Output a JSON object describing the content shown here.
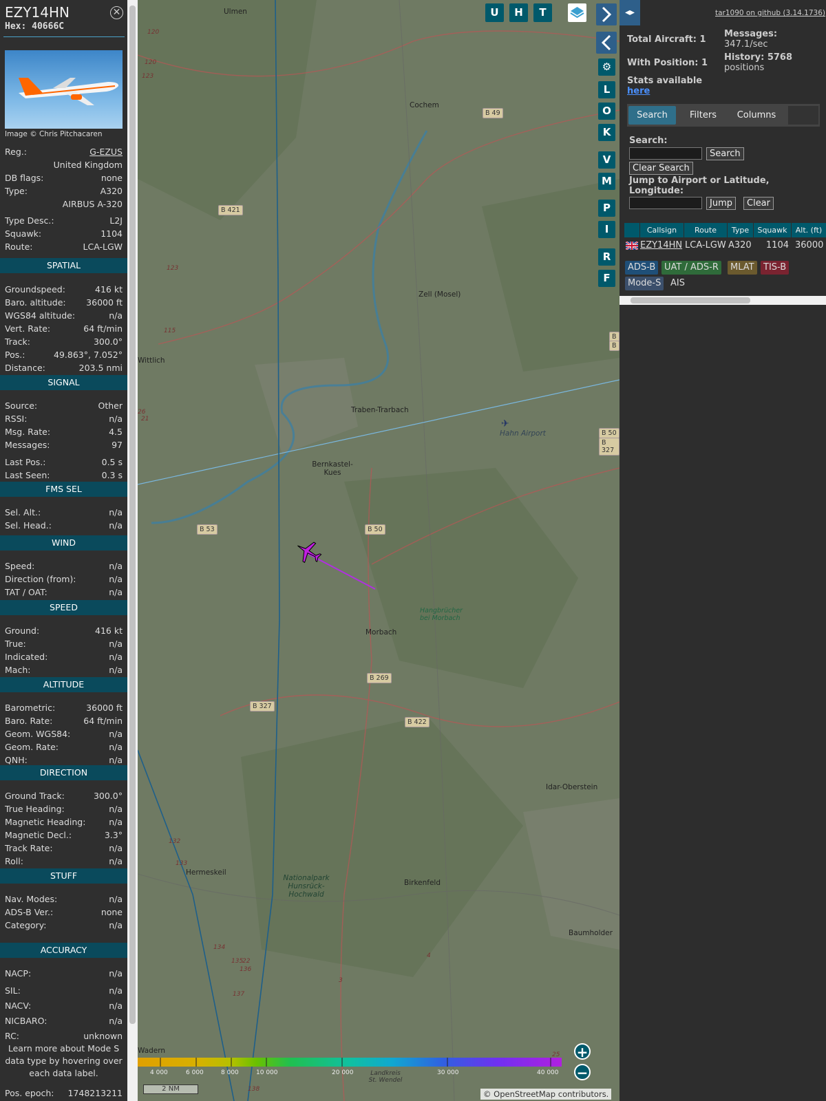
{
  "infoblock": {
    "callsign": "EZY14HN",
    "hex": "Hex: 40666C",
    "photo_caption": "Image © Chris Pitchacaren",
    "general": [
      {
        "k": "Reg.:",
        "v": "G-EZUS",
        "link": true
      },
      {
        "k": "",
        "v": "United Kingdom"
      },
      {
        "k": "DB flags:",
        "v": "none"
      },
      {
        "k": "Type:",
        "v": "A320"
      },
      {
        "k": "",
        "v": "AIRBUS A-320"
      },
      {
        "k": "Type Desc.:",
        "v": "L2J"
      },
      {
        "k": "Squawk:",
        "v": "1104"
      },
      {
        "k": "Route:",
        "v": "LCA-LGW"
      }
    ],
    "sections": [
      {
        "title": "SPATIAL",
        "rows": [
          {
            "k": "Groundspeed:",
            "v": "416 kt"
          },
          {
            "k": "Baro. altitude:",
            "v": "36000 ft"
          },
          {
            "k": "WGS84 altitude:",
            "v": "n/a"
          },
          {
            "k": "Vert. Rate:",
            "v": "64 ft/min"
          },
          {
            "k": "Track:",
            "v": "300.0°"
          },
          {
            "k": "Pos.:",
            "v": "49.863°, 7.052°"
          },
          {
            "k": "Distance:",
            "v": "203.5 nmi"
          }
        ]
      },
      {
        "title": "SIGNAL",
        "rows": [
          {
            "k": "Source:",
            "v": "Other"
          },
          {
            "k": "RSSI:",
            "v": "n/a"
          },
          {
            "k": "Msg. Rate:",
            "v": "4.5"
          },
          {
            "k": "Messages:",
            "v": "97"
          },
          {
            "k": "Last Pos.:",
            "v": "0.5 s"
          },
          {
            "k": "Last Seen:",
            "v": "0.3 s"
          }
        ]
      },
      {
        "title": "FMS SEL",
        "rows": [
          {
            "k": "Sel. Alt.:",
            "v": "n/a"
          },
          {
            "k": "Sel. Head.:",
            "v": "n/a"
          }
        ]
      },
      {
        "title": "WIND",
        "rows": [
          {
            "k": "Speed:",
            "v": "n/a"
          },
          {
            "k": "Direction (from):",
            "v": "n/a"
          },
          {
            "k": "TAT / OAT:",
            "v": "n/a"
          }
        ]
      },
      {
        "title": "SPEED",
        "rows": [
          {
            "k": "Ground:",
            "v": "416 kt"
          },
          {
            "k": "True:",
            "v": "n/a"
          },
          {
            "k": "Indicated:",
            "v": "n/a"
          },
          {
            "k": "Mach:",
            "v": "n/a"
          }
        ]
      },
      {
        "title": "ALTITUDE",
        "rows": [
          {
            "k": "Barometric:",
            "v": "36000 ft"
          },
          {
            "k": "Baro. Rate:",
            "v": "64 ft/min"
          },
          {
            "k": "Geom. WGS84:",
            "v": "n/a"
          },
          {
            "k": "Geom. Rate:",
            "v": "n/a"
          },
          {
            "k": "QNH:",
            "v": "n/a"
          }
        ]
      },
      {
        "title": "DIRECTION",
        "rows": [
          {
            "k": "Ground Track:",
            "v": "300.0°"
          },
          {
            "k": "True Heading:",
            "v": "n/a"
          },
          {
            "k": "Magnetic Heading:",
            "v": "n/a"
          },
          {
            "k": "Magnetic Decl.:",
            "v": "3.3°"
          },
          {
            "k": "Track Rate:",
            "v": "n/a"
          },
          {
            "k": "Roll:",
            "v": "n/a"
          }
        ]
      },
      {
        "title": "STUFF",
        "rows": [
          {
            "k": "Nav. Modes:",
            "v": "n/a"
          },
          {
            "k": "ADS-B Ver.:",
            "v": "none"
          },
          {
            "k": "Category:",
            "v": "n/a"
          }
        ]
      },
      {
        "title": "ACCURACY",
        "rows": [
          {
            "k": "NACP:",
            "v": "n/a"
          },
          {
            "k": "SIL:",
            "v": "n/a"
          },
          {
            "k": "NACV:",
            "v": "n/a"
          },
          {
            "k": "NICBARO:",
            "v": "n/a"
          },
          {
            "k": "RC:",
            "v": "unknown"
          }
        ]
      }
    ],
    "learn_more": "Learn more about Mode S data type by hovering over each data label.",
    "pos_epoch_label": "Pos. epoch:",
    "pos_epoch_value": "1748213211"
  },
  "map": {
    "places": [
      "Ulmen",
      "Cochem",
      "Zell (Mosel)",
      "Wittlich",
      "Traben-Trarbach",
      "Hahn Airport",
      "Bernkastel-Kues",
      "Morbach",
      "Hangbrücher bei Morbach",
      "Idar-Oberstein",
      "Hermeskeil",
      "Nationalpark Hunsrück-Hochwald",
      "Birkenfeld",
      "Baumholder",
      "Wadern",
      "Landkreis St. Wendel"
    ],
    "roads": [
      "B 49",
      "B 421",
      "B 50",
      "B 327",
      "B 53",
      "B 50",
      "B 269",
      "B 327",
      "B 422",
      "B",
      "B"
    ],
    "small_numbers": [
      "120",
      "120",
      "123",
      "123",
      "115",
      "26",
      "21",
      "132",
      "133",
      "134",
      "135",
      "22",
      "136",
      "137",
      "138",
      "4",
      "25",
      "3"
    ],
    "layer_buttons": [
      "U",
      "H",
      "T"
    ],
    "side_buttons": [
      "L",
      "O",
      "K",
      "V",
      "M",
      "P",
      "I",
      "R",
      "F"
    ],
    "altitude_scale": [
      "4 000",
      "6 000",
      "8 000",
      "10 000",
      "20 000",
      "30 000",
      "40 000"
    ],
    "scale_label": "2 NM",
    "attribution_prefix": "© OpenStreetMap",
    "attribution_suffix": " contributors.",
    "zoom_in": "+",
    "zoom_out": "−"
  },
  "panel": {
    "github_link": "tar1090 on github (3.14.1736)",
    "total_aircraft": "Total Aircraft: 1",
    "with_position": "With Position: 1",
    "messages_label": "Messages:",
    "messages_value": "347.1/sec",
    "history_label": "History: 5768",
    "history_value": "positions",
    "stats_text": "Stats available",
    "stats_link": "here",
    "tabs": [
      "Search",
      "Filters",
      "Columns"
    ],
    "search_label": "Search:",
    "search_button": "Search",
    "clear_search_button": "Clear Search",
    "jump_label": "Jump to Airport or Latitude, Longitude:",
    "jump_button": "Jump",
    "clear_button": "Clear",
    "table_headers": [
      "Callsign",
      "Route",
      "Type",
      "Squawk",
      "Alt. (ft)"
    ],
    "table_row": {
      "callsign": "EZY14HN",
      "route": "LCA-LGW",
      "type": "A320",
      "squawk": "1104",
      "alt": "36000"
    },
    "sources": [
      {
        "label": "ADS-B",
        "color": "#1f4f78"
      },
      {
        "label": "UAT / ADS-R",
        "color": "#2f6b3a"
      },
      {
        "label": "MLAT",
        "color": "#6b5a2e"
      },
      {
        "label": "TIS-B",
        "color": "#7a2330"
      },
      {
        "label": "Mode-S",
        "color": "#3b4f6b"
      },
      {
        "label": "AIS",
        "color": "transparent"
      }
    ]
  }
}
